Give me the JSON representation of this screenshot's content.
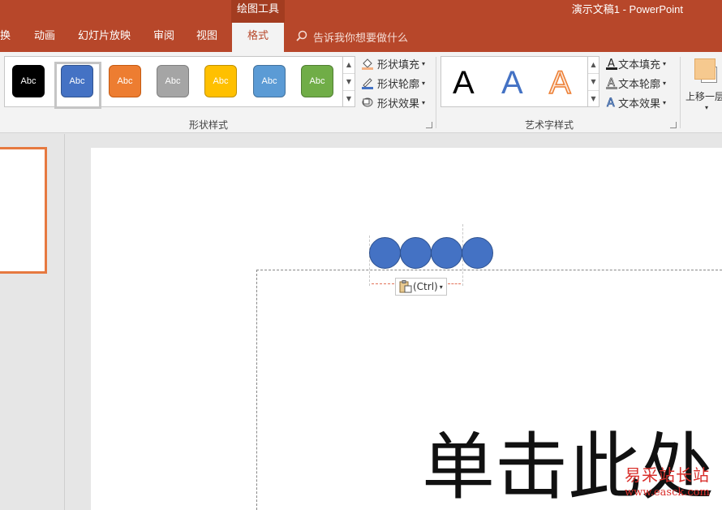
{
  "titlebar": {
    "context_tools": "绘图工具",
    "app_title": "演示文稿1  -  PowerPoint"
  },
  "tabs": {
    "items": [
      {
        "label": "换"
      },
      {
        "label": "动画"
      },
      {
        "label": "幻灯片放映"
      },
      {
        "label": "审阅"
      },
      {
        "label": "视图"
      },
      {
        "label": "格式"
      }
    ],
    "active": "格式",
    "tell_me_placeholder": "告诉我你想要做什么"
  },
  "shape_styles": {
    "group_label": "形状样式",
    "swatches": [
      {
        "label": "Abc",
        "fill": "#000000",
        "text": "#ffffff"
      },
      {
        "label": "Abc",
        "fill": "#4472c4",
        "text": "#ffffff"
      },
      {
        "label": "Abc",
        "fill": "#ed7d31",
        "text": "#ffffff"
      },
      {
        "label": "Abc",
        "fill": "#a5a5a5",
        "text": "#ffffff"
      },
      {
        "label": "Abc",
        "fill": "#ffc000",
        "text": "#ffffff"
      },
      {
        "label": "Abc",
        "fill": "#5b9bd5",
        "text": "#ffffff"
      },
      {
        "label": "Abc",
        "fill": "#70ad47",
        "text": "#ffffff"
      }
    ],
    "fill_label": "形状填充",
    "outline_label": "形状轮廓",
    "effects_label": "形状效果"
  },
  "wordart_styles": {
    "group_label": "艺术字样式",
    "letters": [
      {
        "label": "A",
        "style": "black"
      },
      {
        "label": "A",
        "style": "blue"
      },
      {
        "label": "A",
        "style": "orange-outline"
      }
    ],
    "text_fill_label": "文本填充",
    "text_outline_label": "文本轮廓",
    "text_effects_label": "文本效果"
  },
  "arrange": {
    "bring_forward_label": "上移一层"
  },
  "slide": {
    "paste_options_label": "(Ctrl)",
    "title_text": "单击此处"
  },
  "watermark": {
    "line1": "易采站长站",
    "line2": "www.easck.com"
  },
  "colors": {
    "accent": "#b7472a",
    "circle_fill": "#4472c4",
    "thumb_border": "#e67940"
  }
}
